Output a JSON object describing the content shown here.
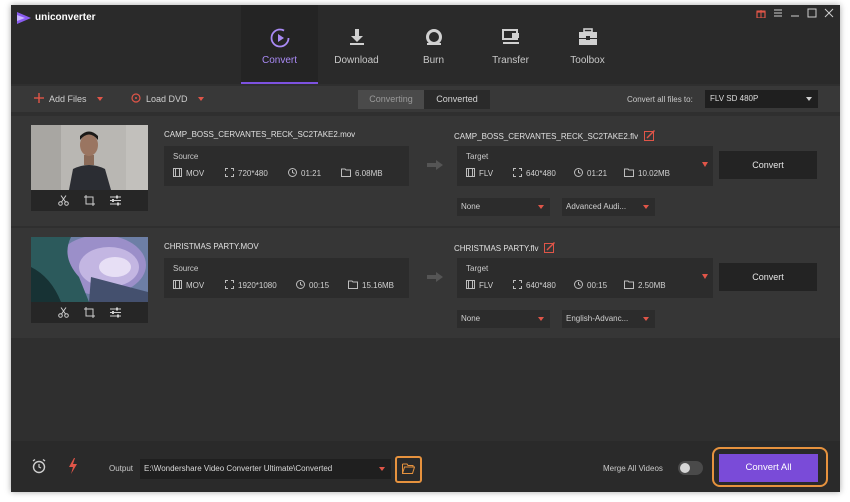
{
  "app": {
    "title": "uniconverter"
  },
  "nav": [
    {
      "label": "Convert",
      "icon": "convert-icon",
      "active": true
    },
    {
      "label": "Download",
      "icon": "download-icon",
      "active": false
    },
    {
      "label": "Burn",
      "icon": "burn-icon",
      "active": false
    },
    {
      "label": "Transfer",
      "icon": "transfer-icon",
      "active": false
    },
    {
      "label": "Toolbox",
      "icon": "toolbox-icon",
      "active": false
    }
  ],
  "toolbar": {
    "add_files": "Add Files",
    "load_dvd": "Load DVD",
    "tab_converting": "Converting",
    "tab_converted": "Converted",
    "convert_all_label": "Convert all files to:",
    "format": "FLV SD 480P"
  },
  "files": [
    {
      "source_name": "CAMP_BOSS_CERVANTES_RECK_SC2TAKE2.mov",
      "target_name": "CAMP_BOSS_CERVANTES_RECK_SC2TAKE2.flv",
      "source": {
        "label": "Source",
        "format": "MOV",
        "resolution": "720*480",
        "duration": "01:21",
        "size": "6.08MB"
      },
      "target": {
        "label": "Target",
        "format": "FLV",
        "resolution": "640*480",
        "duration": "01:21",
        "size": "10.02MB"
      },
      "subtitle": "None",
      "audio": "Advanced Audi...",
      "convert_label": "Convert"
    },
    {
      "source_name": "CHRISTMAS PARTY.MOV",
      "target_name": "CHRISTMAS PARTY.flv",
      "source": {
        "label": "Source",
        "format": "MOV",
        "resolution": "1920*1080",
        "duration": "00:15",
        "size": "15.16MB"
      },
      "target": {
        "label": "Target",
        "format": "FLV",
        "resolution": "640*480",
        "duration": "00:15",
        "size": "2.50MB"
      },
      "subtitle": "None",
      "audio": "English-Advanc...",
      "convert_label": "Convert"
    }
  ],
  "bottom": {
    "output_label": "Output",
    "output_path": "E:\\Wondershare Video Converter Ultimate\\Converted",
    "merge_label": "Merge All Videos",
    "merge_on": false,
    "convert_all": "Convert All"
  },
  "colors": {
    "accent": "#7a4bd8",
    "highlight": "#e6923e",
    "red": "#e05548"
  }
}
